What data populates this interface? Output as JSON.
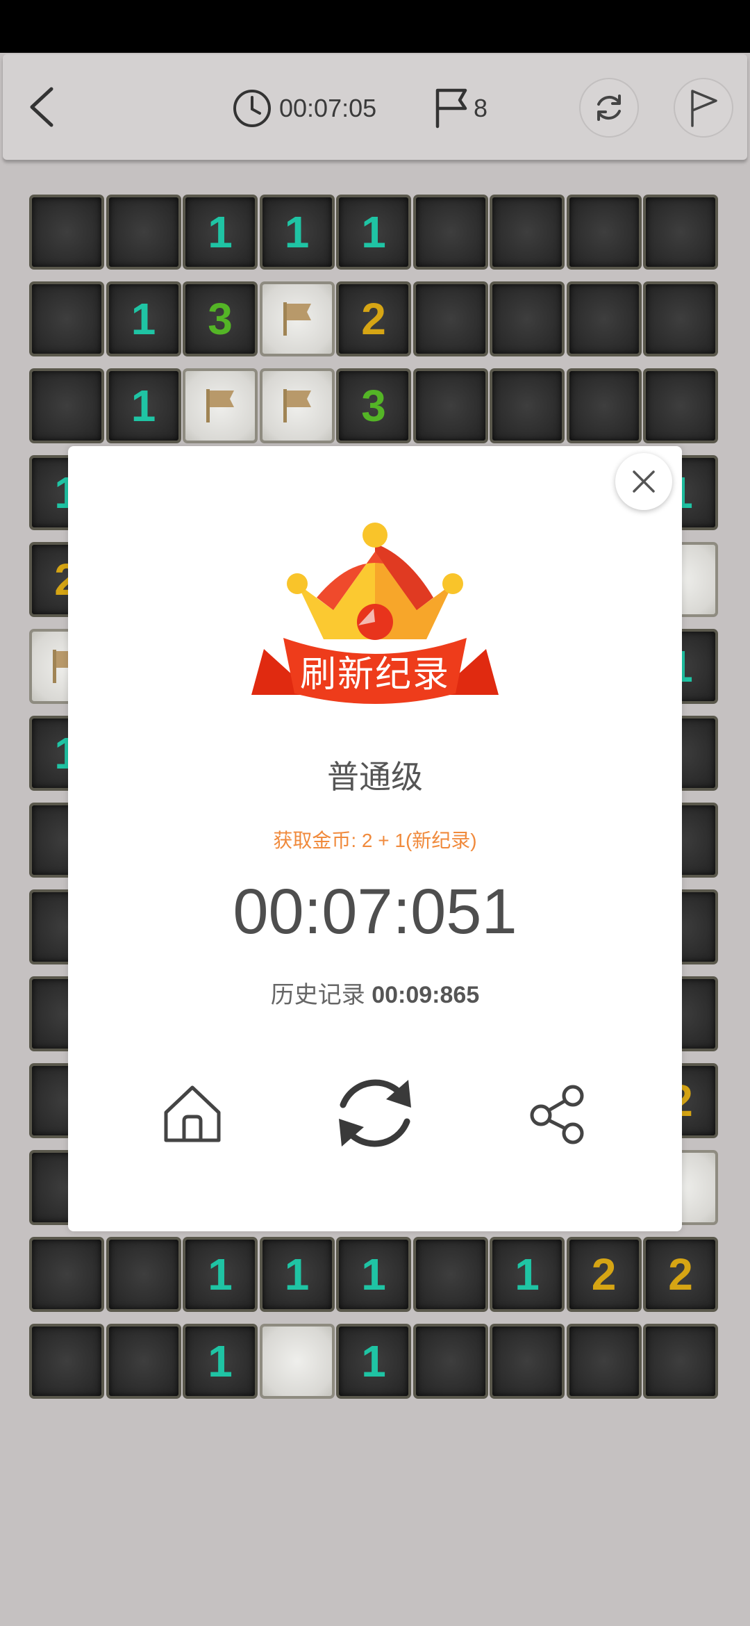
{
  "toolbar": {
    "timer": "00:07:05",
    "flags_remaining": "8"
  },
  "board": {
    "cols": 9,
    "rows": 14,
    "cells": [
      [
        "h",
        "h",
        "1",
        "1",
        "1",
        "h",
        "h",
        "h",
        "h"
      ],
      [
        "h",
        "1",
        "3",
        "F",
        "2",
        "h",
        "h",
        "h",
        "h"
      ],
      [
        "h",
        "1",
        "F",
        "F",
        "3",
        "h",
        "h",
        "h",
        "h"
      ],
      [
        "1",
        "?",
        "?",
        "?",
        "?",
        "?",
        "?",
        "?",
        "1"
      ],
      [
        "2",
        "?",
        "?",
        "?",
        "?",
        "?",
        "?",
        "?",
        "o"
      ],
      [
        "F",
        "?",
        "?",
        "?",
        "?",
        "?",
        "?",
        "?",
        "1"
      ],
      [
        "1",
        "?",
        "?",
        "?",
        "?",
        "?",
        "?",
        "?",
        "h"
      ],
      [
        "h",
        "?",
        "?",
        "?",
        "?",
        "?",
        "?",
        "?",
        "h"
      ],
      [
        "h",
        "?",
        "?",
        "?",
        "?",
        "?",
        "?",
        "?",
        "h"
      ],
      [
        "h",
        "?",
        "?",
        "?",
        "?",
        "?",
        "?",
        "?",
        "h"
      ],
      [
        "h",
        "?",
        "?",
        "?",
        "?",
        "?",
        "?",
        "?",
        "2"
      ],
      [
        "h",
        "?",
        "?",
        "?",
        "?",
        "?",
        "?",
        "?",
        "o"
      ],
      [
        "h",
        "h",
        "1",
        "1",
        "1",
        "h",
        "1",
        "2",
        "2"
      ],
      [
        "h",
        "h",
        "1",
        "o",
        "1",
        "h",
        "h",
        "h",
        "h"
      ]
    ],
    "number_colors": {
      "1": "#1fc4a4",
      "2": "#d6a514",
      "3": "#54b526"
    }
  },
  "result": {
    "badge_text": "刷新纪录",
    "level": "普通级",
    "coins_text": "获取金币: 2 + 1(新纪录)",
    "time": "00:07:051",
    "history_label": "历史记录",
    "history_time": "00:09:865"
  },
  "colors": {
    "background": "#c5c1c1",
    "toolbar": "#d4d1d1",
    "coins": "#f08a3c",
    "badge_red": "#e8341c",
    "badge_gold": "#f9c42a"
  }
}
